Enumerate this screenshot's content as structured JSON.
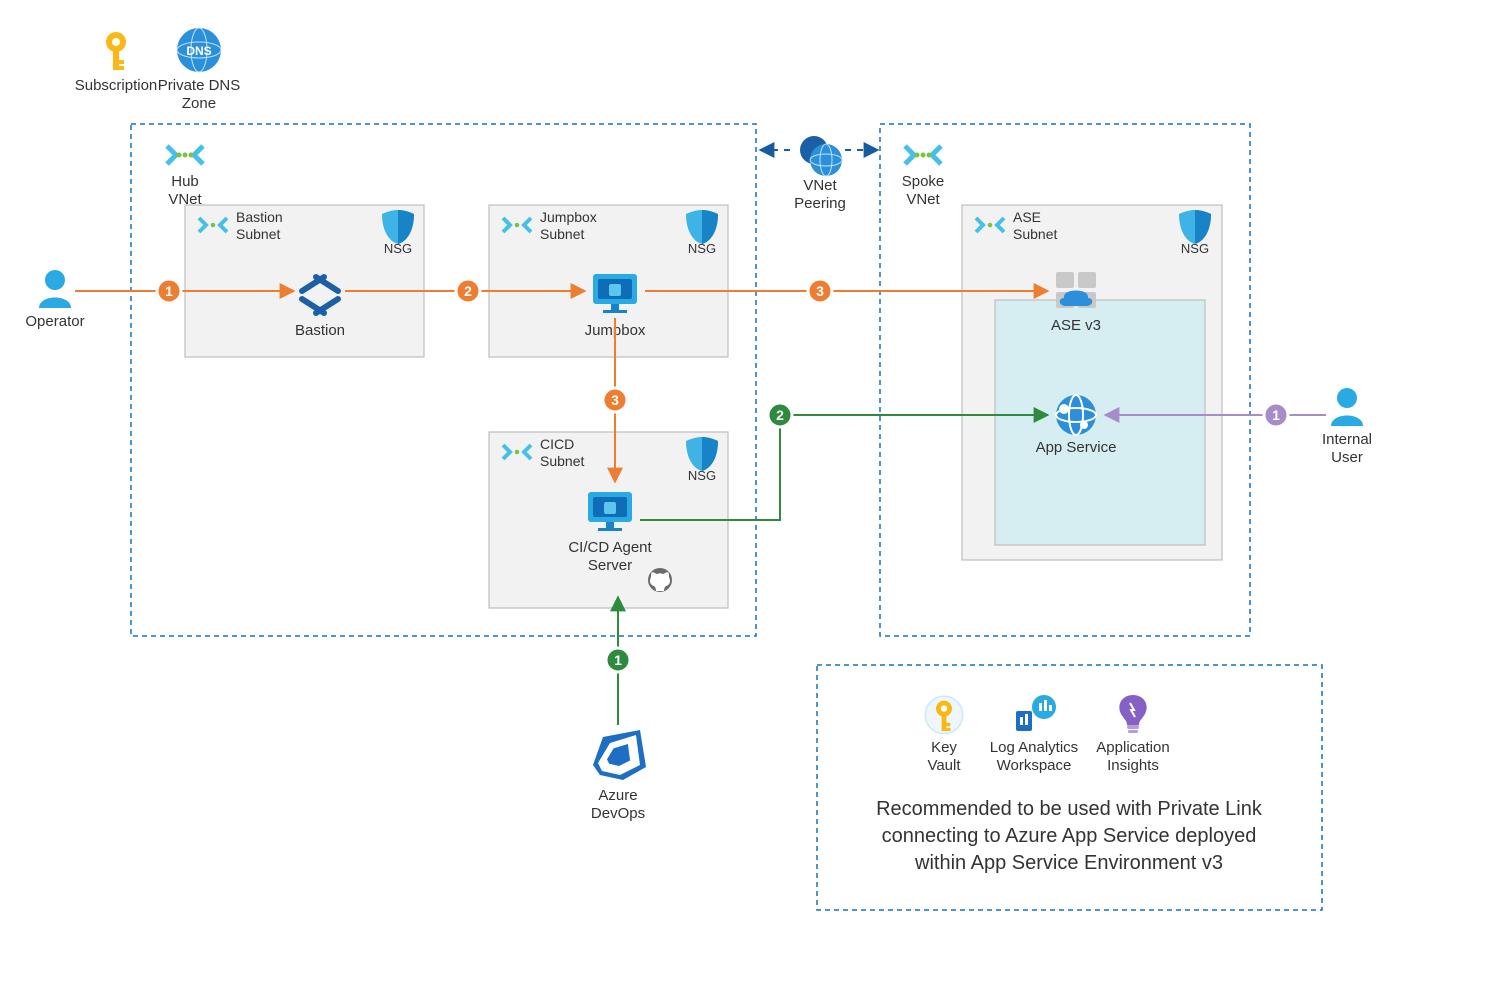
{
  "header": {
    "subscription": "Subscription",
    "private_dns": "Private DNS",
    "private_dns2": "Zone"
  },
  "vnets": {
    "hub": {
      "label1": "Hub",
      "label2": "VNet"
    },
    "spoke": {
      "label1": "Spoke",
      "label2": "VNet"
    },
    "peering": {
      "label1": "VNet",
      "label2": "Peering"
    }
  },
  "subnets": {
    "bastion": {
      "label1": "Bastion",
      "label2": "Subnet"
    },
    "jumpbox": {
      "label1": "Jumpbox",
      "label2": "Subnet"
    },
    "cicd": {
      "label1": "CICD",
      "label2": "Subnet"
    },
    "ase": {
      "label1": "ASE",
      "label2": "Subnet"
    }
  },
  "nsg": "NSG",
  "nodes": {
    "operator": "Operator",
    "bastion": "Bastion",
    "jumpbox": "Jumpbox",
    "cicd_agent": {
      "l1": "CI/CD Agent",
      "l2": "Server"
    },
    "asev3": "ASE v3",
    "appservice": "App Service",
    "azure_devops": {
      "l1": "Azure",
      "l2": "DevOps"
    },
    "internal_user": {
      "l1": "Internal",
      "l2": "User"
    }
  },
  "legend": {
    "keyvault": {
      "l1": "Key",
      "l2": "Vault"
    },
    "loganalytics": {
      "l1": "Log Analytics",
      "l2": "Workspace"
    },
    "appinsights": {
      "l1": "Application",
      "l2": "Insights"
    }
  },
  "recommendation": {
    "l1": "Recommended to be used with Private Link",
    "l2": "connecting to Azure App Service deployed",
    "l3": "within App Service Environment v3"
  },
  "flows": {
    "orange": [
      "1",
      "2",
      "3",
      "3"
    ],
    "green": [
      "1",
      "2"
    ],
    "purple": [
      "1"
    ]
  },
  "colors": {
    "orange": "#ed7d31",
    "green": "#2e8b3e",
    "purple": "#a88cc7",
    "azure": "#2aaae2",
    "azureDark": "#0f6db8",
    "key": "#fbb714"
  }
}
